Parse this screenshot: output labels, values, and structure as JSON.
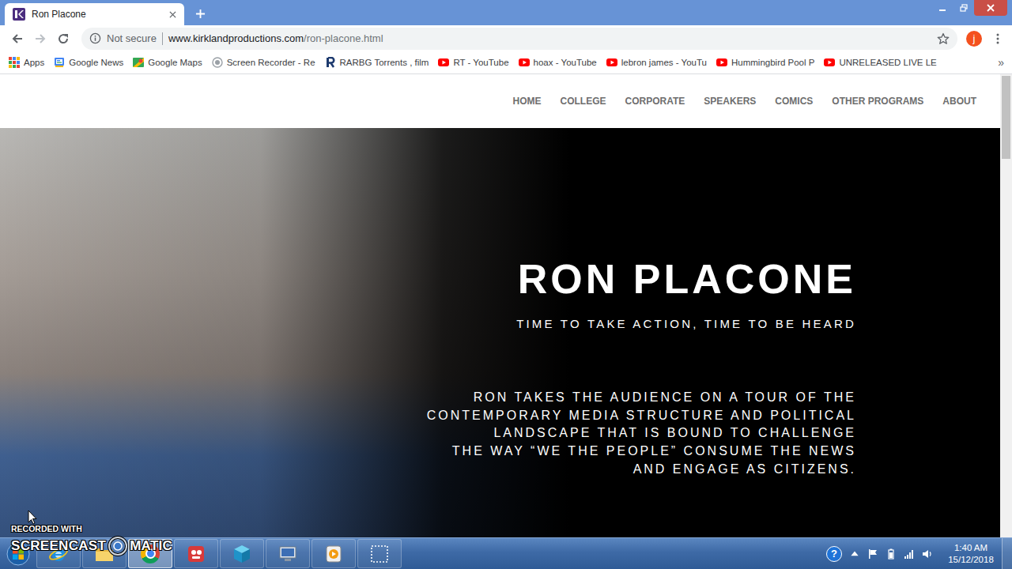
{
  "browser": {
    "tabs": [
      {
        "title": "Ron Placone",
        "selected": true
      }
    ],
    "nav_buttons": {
      "back_enabled": true,
      "forward_enabled": false
    },
    "address_bar": {
      "security": "Not secure",
      "host": "www.kirklandproductions.com",
      "path": "/ron-placone.html"
    },
    "profile": {
      "initial": "j"
    },
    "bookmarks": [
      {
        "label": "Apps",
        "kind": "apps"
      },
      {
        "label": "Google News",
        "kind": "news"
      },
      {
        "label": "Google Maps",
        "kind": "maps"
      },
      {
        "label": "Screen Recorder - Re",
        "kind": "recorder"
      },
      {
        "label": "RARBG Torrents , film",
        "kind": "rarbg"
      },
      {
        "label": "RT - YouTube",
        "kind": "youtube"
      },
      {
        "label": "hoax - YouTube",
        "kind": "youtube"
      },
      {
        "label": "lebron james - YouTu",
        "kind": "youtube"
      },
      {
        "label": "Hummingbird Pool P",
        "kind": "youtube"
      },
      {
        "label": "UNRELEASED LIVE LE",
        "kind": "youtube"
      }
    ],
    "bookmarks_overflow": "»"
  },
  "page": {
    "nav": [
      "HOME",
      "COLLEGE",
      "CORPORATE",
      "SPEAKERS",
      "COMICS",
      "OTHER PROGRAMS",
      "ABOUT"
    ],
    "hero": {
      "title": "RON PLACONE",
      "tagline": "TIME TO TAKE ACTION, TIME TO BE HEARD",
      "description": [
        "RON TAKES THE AUDIENCE ON A TOUR OF THE",
        "CONTEMPORARY MEDIA STRUCTURE AND POLITICAL",
        "LANDSCAPE THAT IS BOUND TO CHALLENGE",
        "THE WAY “WE THE PEOPLE” CONSUME THE NEWS",
        "AND ENGAGE AS CITIZENS."
      ]
    },
    "scrollbar": {
      "level": 0.18
    }
  },
  "taskbar": {
    "apps": [
      {
        "kind": "ie",
        "selected": false
      },
      {
        "kind": "explorer",
        "selected": false
      },
      {
        "kind": "chrome",
        "selected": true
      },
      {
        "kind": "recorder",
        "selected": false
      },
      {
        "kind": "cube",
        "selected": false
      },
      {
        "kind": "network",
        "selected": false
      },
      {
        "kind": "media",
        "selected": false
      },
      {
        "kind": "snip",
        "selected": false
      }
    ],
    "tray": {
      "help": "?",
      "time": "1:40 AM",
      "date": "15/12/2018"
    }
  },
  "watermark": {
    "caption": "RECORDED WITH",
    "brand_left": "SCREENCAST",
    "brand_right": "MATIC"
  }
}
